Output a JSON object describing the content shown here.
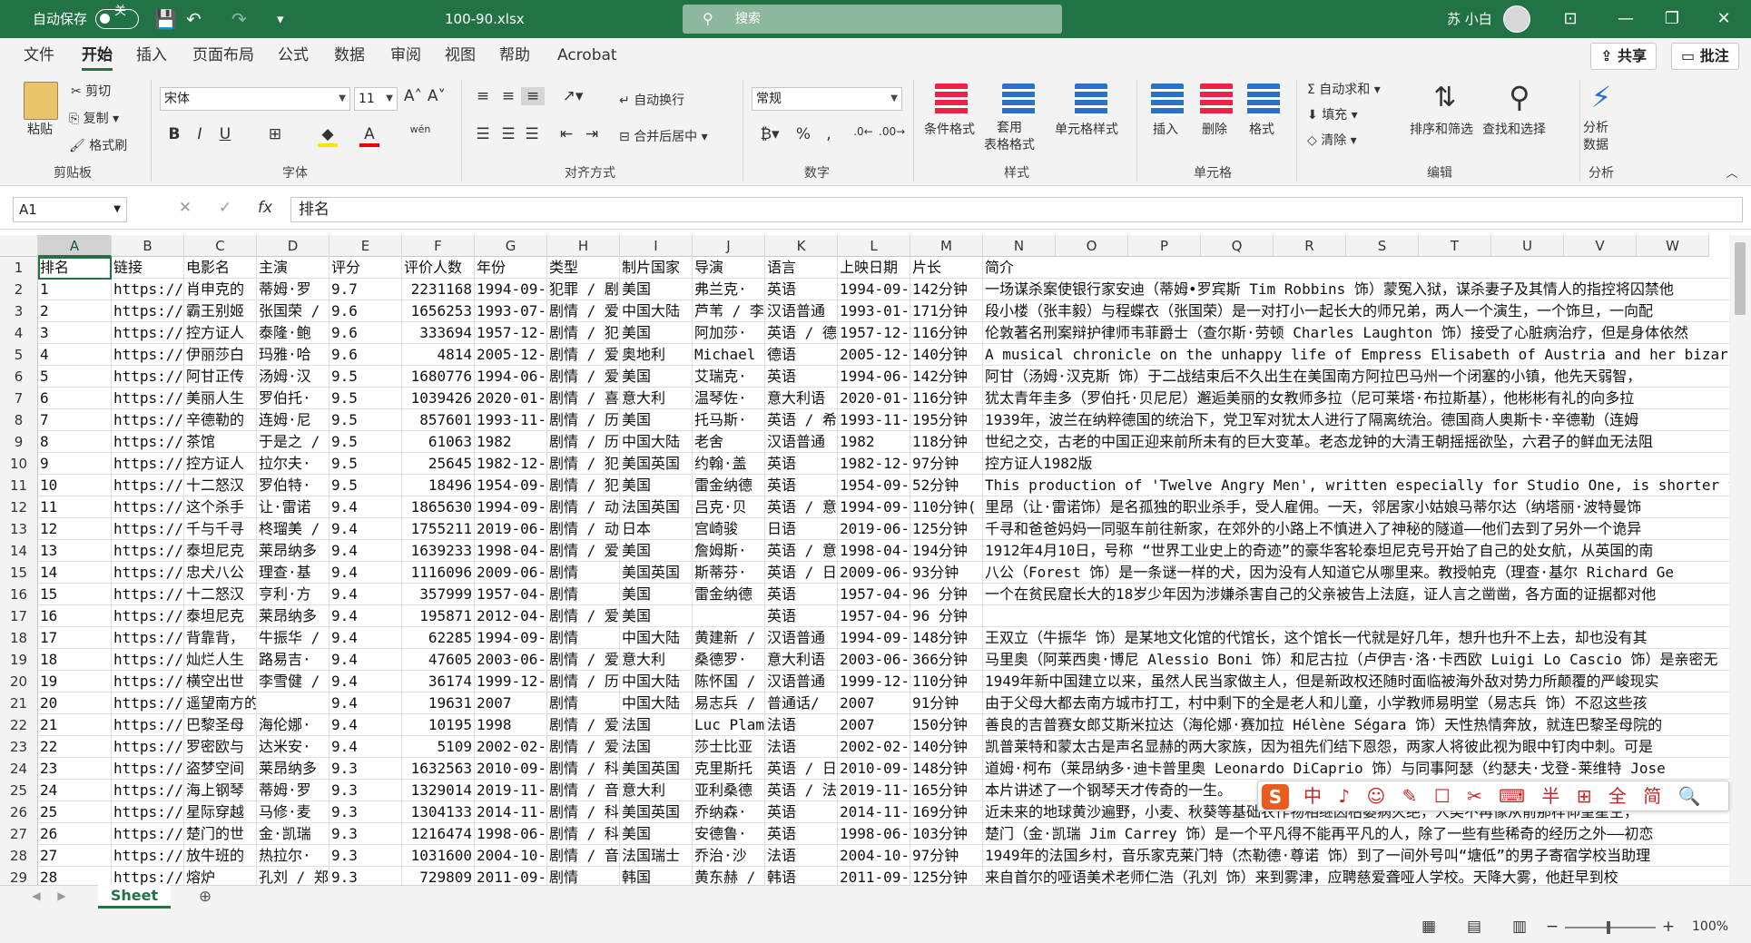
{
  "titlebar": {
    "autosave_label": "自动保存",
    "autosave_state": "关",
    "filename": "100-90.xlsx",
    "search_placeholder": "搜索",
    "username": "苏 小白"
  },
  "menu": {
    "items": [
      "文件",
      "开始",
      "插入",
      "页面布局",
      "公式",
      "数据",
      "审阅",
      "视图",
      "帮助",
      "Acrobat"
    ],
    "active": "开始",
    "share": "共享",
    "comments": "批注"
  },
  "ribbon": {
    "clipboard": {
      "paste": "粘贴",
      "cut": "剪切",
      "copy": "复制",
      "format_painter": "格式刷",
      "group": "剪贴板"
    },
    "font": {
      "name": "宋体",
      "size": "11",
      "group": "字体",
      "bold": "B",
      "italic": "I",
      "underline": "U",
      "wen": "wén"
    },
    "alignment": {
      "wrap": "自动换行",
      "merge": "合并后居中",
      "group": "对齐方式"
    },
    "number": {
      "format": "常规",
      "group": "数字"
    },
    "styles": {
      "conditional": "条件格式",
      "table": "套用\n表格格式",
      "cell_styles": "单元格样式",
      "group": "样式"
    },
    "cells": {
      "insert": "插入",
      "delete": "删除",
      "format": "格式",
      "group": "单元格"
    },
    "editing": {
      "autosum": "自动求和",
      "fill": "填充",
      "clear": "清除",
      "sort": "排序和筛选",
      "find": "查找和选择",
      "group": "编辑"
    },
    "analysis": {
      "analyze": "分析\n数据",
      "group": "分析"
    }
  },
  "formula_bar": {
    "name_box": "A1",
    "formula": "排名"
  },
  "columns": [
    {
      "letter": "A"
    },
    {
      "letter": "B"
    },
    {
      "letter": "C"
    },
    {
      "letter": "D"
    },
    {
      "letter": "E"
    },
    {
      "letter": "F"
    },
    {
      "letter": "G"
    },
    {
      "letter": "H"
    },
    {
      "letter": "I"
    },
    {
      "letter": "J"
    },
    {
      "letter": "K"
    },
    {
      "letter": "L"
    },
    {
      "letter": "M"
    },
    {
      "letter": "N"
    },
    {
      "letter": "O"
    },
    {
      "letter": "P"
    },
    {
      "letter": "Q"
    },
    {
      "letter": "R"
    },
    {
      "letter": "S"
    },
    {
      "letter": "T"
    },
    {
      "letter": "U"
    },
    {
      "letter": "V"
    },
    {
      "letter": "W"
    }
  ],
  "rows": [
    [
      "1",
      "排名",
      "链接",
      "电影名",
      "主演",
      "评分",
      "评价人数",
      "年份",
      "类型",
      "制片国家",
      "导演",
      "语言",
      "上映日期",
      "片长",
      "简介"
    ],
    [
      "2",
      "1",
      "https://m",
      "肖申克的",
      "蒂姆·罗",
      "9.7",
      "2231168",
      "1994-09-",
      "犯罪 / 剧",
      "美国",
      "弗兰克·",
      "英语",
      "1994-09-",
      "142分钟",
      "一场谋杀案使银行家安迪（蒂姆•罗宾斯 Tim Robbins 饰）蒙冤入狱，谋杀妻子及其情人的指控将囚禁他"
    ],
    [
      "3",
      "2",
      "https://m",
      "霸王别姬",
      "张国荣 /",
      "9.6",
      "1656253",
      "1993-07-",
      "剧情 / 爱",
      "中国大陆",
      "芦苇 / 李",
      "汉语普通",
      "1993-01-",
      "171分钟",
      "段小楼（张丰毅）与程蝶衣（张国荣）是一对打小一起长大的师兄弟，两人一个演生，一个饰旦，一向配"
    ],
    [
      "4",
      "3",
      "https://m",
      "控方证人",
      "泰隆·鲍",
      "9.6",
      "333694",
      "1957-12-",
      "剧情 / 犯",
      "美国",
      "阿加莎·",
      "英语 / 德",
      "1957-12-",
      "116分钟",
      "伦敦著名刑案辩护律师韦菲爵士（查尔斯·劳顿 Charles Laughton 饰）接受了心脏病治疗，但是身体依然"
    ],
    [
      "5",
      "4",
      "https://m",
      "伊丽莎白",
      "玛雅·哈",
      "9.6",
      "4814",
      "2005-12-",
      "剧情 / 爱",
      "奥地利",
      "Michael K",
      "德语",
      "2005-12-",
      "140分钟",
      "A musical chronicle on the unhappy life of Empress Elisabeth of Austria and her bizarre lov"
    ],
    [
      "6",
      "5",
      "https://m",
      "阿甘正传",
      "汤姆·汉",
      "9.5",
      "1680776",
      "1994-06-",
      "剧情 / 爱",
      "美国",
      "艾瑞克·",
      "英语",
      "1994-06-",
      "142分钟",
      "阿甘（汤姆·汉克斯 饰）于二战结束后不久出生在美国南方阿拉巴马州一个闭塞的小镇，他先天弱智，"
    ],
    [
      "7",
      "6",
      "https://m",
      "美丽人生",
      "罗伯托·",
      "9.5",
      "1039426",
      "2020-01-",
      "剧情 / 喜",
      "意大利",
      "温琴佐·",
      "意大利语",
      "2020-01-",
      "116分钟",
      "犹太青年圭多（罗伯托·贝尼尼）邂逅美丽的女教师多拉（尼可莱塔·布拉斯基），他彬彬有礼的向多拉"
    ],
    [
      "8",
      "7",
      "https://m",
      "辛德勒的",
      "连姆·尼",
      "9.5",
      "857601",
      "1993-11-",
      "剧情 / 历",
      "美国",
      "托马斯·",
      "英语 / 希",
      "1993-11-",
      "195分钟",
      "1939年，波兰在纳粹德国的统治下，党卫军对犹太人进行了隔离统治。德国商人奥斯卡·辛德勒（连姆"
    ],
    [
      "9",
      "8",
      "https://m",
      "茶馆",
      "于是之 /",
      "9.5",
      "61063",
      "1982",
      "剧情 / 历",
      "中国大陆",
      "老舍",
      "汉语普通",
      "1982",
      "118分钟",
      "世纪之交，古老的中国正迎来前所未有的巨大变革。老态龙钟的大清王朝摇摇欲坠，六君子的鲜血无法阻"
    ],
    [
      "10",
      "9",
      "https://m",
      "控方证人",
      "拉尔夫·",
      "9.5",
      "25645",
      "1982-12-",
      "剧情 / 犯",
      "美国英国",
      "约翰·盖",
      "英语",
      "1982-12-",
      "97分钟",
      "控方证人1982版"
    ],
    [
      "11",
      "10",
      "https://m",
      "十二怒汉",
      "罗伯特·",
      "9.5",
      "18496",
      "1954-09-",
      "剧情 / 犯",
      "美国",
      "雷金纳德",
      "英语",
      "1954-09-",
      "52分钟",
      "This production of 'Twelve Angry Men', written especially for Studio One, is shorter than t"
    ],
    [
      "12",
      "11",
      "https://m",
      "这个杀手",
      "让·雷诺",
      "9.4",
      "1865630",
      "1994-09-",
      "剧情 / 动",
      "法国英国",
      "吕克·贝",
      "英语 / 意",
      "1994-09-",
      "110分钟(",
      "里昂（让·雷诺饰）是名孤独的职业杀手，受人雇佣。一天，邻居家小姑娘马蒂尔达（纳塔丽·波特曼饰"
    ],
    [
      "13",
      "12",
      "https://m",
      "千与千寻",
      "柊瑠美 /",
      "9.4",
      "1755211",
      "2019-06-",
      "剧情 / 动",
      "日本",
      "宫崎骏",
      "日语",
      "2019-06-",
      "125分钟",
      "千寻和爸爸妈妈一同驱车前往新家，在郊外的小路上不慎进入了神秘的隧道——他们去到了另外一个诡异"
    ],
    [
      "14",
      "13",
      "https://m",
      "泰坦尼克",
      "莱昂纳多",
      "9.4",
      "1639233",
      "1998-04-",
      "剧情 / 爱",
      "美国",
      "詹姆斯·",
      "英语 / 意",
      "1998-04-",
      "194分钟",
      "1912年4月10日，号称 “世界工业史上的奇迹”的豪华客轮泰坦尼克号开始了自己的处女航，从英国的南"
    ],
    [
      "15",
      "14",
      "https://m",
      "忠犬八公",
      "理查·基",
      "9.4",
      "1116096",
      "2009-06-",
      "剧情",
      "美国英国",
      "斯蒂芬·",
      "英语 / 日",
      "2009-06-",
      "93分钟",
      "八公（Forest 饰）是一条谜一样的犬，因为没有人知道它从哪里来。教授帕克（理查·基尔 Richard Ge"
    ],
    [
      "16",
      "15",
      "https://m",
      "十二怒汉",
      "亨利·方",
      "9.4",
      "357999",
      "1957-04-",
      "剧情",
      "美国",
      "雷金纳德",
      "英语",
      "1957-04-",
      "96 分钟",
      "一个在贫民窟长大的18岁少年因为涉嫌杀害自己的父亲被告上法庭，证人言之凿凿，各方面的证据都对他"
    ],
    [
      "17",
      "16",
      "https://m",
      "泰坦尼克",
      "莱昂纳多",
      "9.4",
      "195871",
      "2012-04-",
      "剧情 / 爱",
      "美国",
      "",
      "英语",
      "1957-04-",
      "96 分钟",
      ""
    ],
    [
      "18",
      "17",
      "https://m",
      "背靠背，",
      "牛振华 /",
      "9.4",
      "62285",
      "1994-09-",
      "剧情",
      "中国大陆",
      "黄建新 /",
      "汉语普通",
      "1994-09-",
      "148分钟",
      "王双立（牛振华 饰）是某地文化馆的代馆长，这个馆长一代就是好几年，想升也升不上去，却也没有其"
    ],
    [
      "19",
      "18",
      "https://m",
      "灿烂人生",
      "路易吉·",
      "9.4",
      "47605",
      "2003-06-",
      "剧情 / 爱",
      "意大利",
      "桑德罗·",
      "意大利语",
      "2003-06-",
      "366分钟",
      "马里奥（阿莱西奥·博尼 Alessio Boni 饰）和尼古拉（卢伊吉·洛·卡西欧 Luigi Lo Cascio 饰）是亲密无"
    ],
    [
      "20",
      "19",
      "https://m",
      "横空出世",
      "李雪健 /",
      "9.4",
      "36174",
      "1999-12-",
      "剧情 / 历",
      "中国大陆",
      "陈怀国 /",
      "汉语普通",
      "1999-12-",
      "110分钟",
      "1949年新中国建立以来，虽然人民当家做主人，但是新政权还随时面临被海外敌对势力所颠覆的严峻现实"
    ],
    [
      "21",
      "20",
      "https://m",
      "遥望南方的童年",
      "",
      "9.4",
      "19631",
      "2007",
      "剧情",
      "中国大陆",
      "易志兵 /",
      "普通话/",
      "2007",
      "91分钟",
      "由于父母大都去南方城市打工，村中剩下的全是老人和儿童，小学教师易明堂（易志兵 饰）不忍这些孩"
    ],
    [
      "22",
      "21",
      "https://m",
      "巴黎圣母",
      "海伦娜·",
      "9.4",
      "10195",
      "1998",
      "剧情 / 爱",
      "法国",
      "Luc Plamo",
      "法语",
      "2007",
      "150分钟",
      "善良的吉普赛女郎艾斯米拉达（海伦娜·赛加拉 Hélène Ségara 饰）天性热情奔放，就连巴黎圣母院的"
    ],
    [
      "23",
      "22",
      "https://m",
      "罗密欧与",
      "达米安·",
      "9.4",
      "5109",
      "2002-02-",
      "剧情 / 爱",
      "法国",
      "莎士比亚",
      "法语",
      "2002-02-",
      "140分钟",
      "凯普莱特和蒙太古是声名显赫的两大家族，因为祖先们结下恩怨，两家人将彼此视为眼中钉肉中刺。可是"
    ],
    [
      "24",
      "23",
      "https://m",
      "盗梦空间",
      "莱昂纳多",
      "9.3",
      "1632563",
      "2010-09-",
      "剧情 / 科",
      "美国英国",
      "克里斯托",
      "英语 / 日",
      "2010-09-",
      "148分钟",
      "道姆·柯布（莱昂纳多·迪卡普里奥 Leonardo DiCaprio 饰）与同事阿瑟（约瑟夫·戈登-莱维特 Jose"
    ],
    [
      "25",
      "24",
      "https://m",
      "海上钢琴",
      "蒂姆·罗",
      "9.3",
      "1329014",
      "2019-11-",
      "剧情 / 音",
      "意大利",
      "亚利桑德",
      "英语 / 法",
      "2019-11-",
      "165分钟",
      "本片讲述了一个钢琴天才传奇的一生。"
    ],
    [
      "26",
      "25",
      "https://m",
      "星际穿越",
      "马修·麦",
      "9.3",
      "1304133",
      "2014-11-",
      "剧情 / 科",
      "美国英国",
      "乔纳森·",
      "英语",
      "2014-11-",
      "169分钟",
      "近未来的地球黄沙遍野，小麦、秋葵等基础农作物相继因枯萎病灭绝，人类不再像从前那样仰望星空，"
    ],
    [
      "27",
      "26",
      "https://m",
      "楚门的世",
      "金·凯瑞",
      "9.3",
      "1216474",
      "1998-06-",
      "剧情 / 科",
      "美国",
      "安德鲁·",
      "英语",
      "1998-06-",
      "103分钟",
      "楚门（金·凯瑞 Jim Carrey 饰）是一个平凡得不能再平凡的人，除了一些有些稀奇的经历之外——初恋"
    ],
    [
      "28",
      "27",
      "https://m",
      "放牛班的",
      "热拉尔·",
      "9.3",
      "1031600",
      "2004-10-",
      "剧情 / 音",
      "法国瑞士",
      "乔治·沙",
      "法语",
      "2004-10-",
      "97分钟",
      "1949年的法国乡村，音乐家克莱门特（杰勒德·尊诺 饰）到了一间外号叫“塘低”的男子寄宿学校当助理"
    ],
    [
      "29",
      "28",
      "https://m",
      "熔炉",
      "孔刘 / 郑",
      "9.3",
      "729809",
      "2011-09-",
      "剧情",
      "韩国",
      "黄东赫 /",
      "韩语",
      "2011-09-",
      "125分钟",
      "来自首尔的哑语美术老师仁浩（孔刘 饰）来到雾津，应聘慈爱聋哑人学校。天降大雾，他赶早到校"
    ]
  ],
  "sheet": {
    "tab": "Sheet"
  },
  "status": {
    "zoom": "100%"
  },
  "ime": {
    "logo": "S",
    "glyphs": "中 ♪ ☺ ✎ ☐ ✂ ⌨ 半 ⊞ 全 简 🔍"
  }
}
